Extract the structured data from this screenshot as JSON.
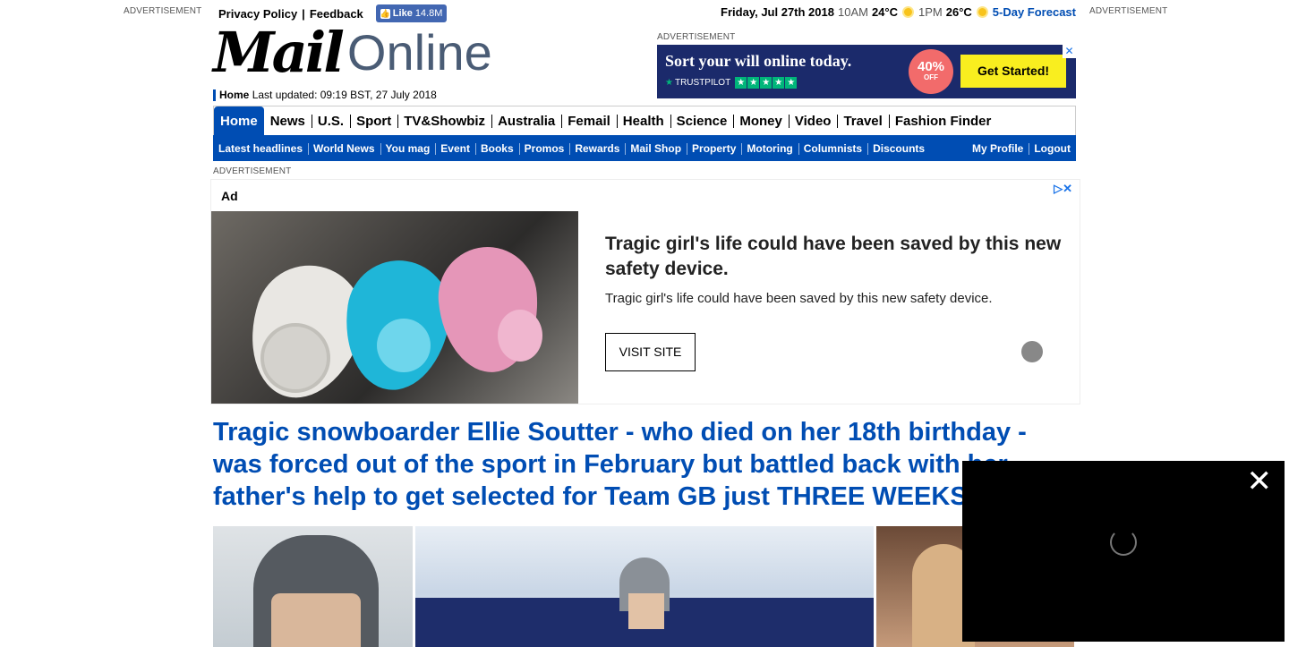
{
  "ads": {
    "left_label": "ADVERTISEMENT",
    "right_label": "ADVERTISEMENT",
    "banner_label": "ADVERTISEMENT",
    "mid_label": "ADVERTISEMENT"
  },
  "topbar": {
    "privacy": "Privacy Policy",
    "feedback": "Feedback",
    "like_label": "Like",
    "like_count": "14.8M"
  },
  "weather": {
    "date": "Friday, Jul 27th 2018",
    "t1_time": "10AM",
    "t1_temp": "24°C",
    "t2_time": "1PM",
    "t2_temp": "26°C",
    "forecast": "5-Day Forecast"
  },
  "logo": {
    "mail": "Mail",
    "online": "Online"
  },
  "updated": {
    "home": "Home",
    "text": "Last updated: 09:19 BST, 27 July 2018"
  },
  "banner": {
    "headline": "Sort your will online today.",
    "trustpilot": "TRUSTPILOT",
    "stars": [
      "★",
      "★",
      "★",
      "★",
      "★"
    ],
    "pct": "40%",
    "off": "OFF",
    "cta": "Get Started!",
    "close": "✕"
  },
  "nav_primary": [
    "Home",
    "News",
    "U.S.",
    "Sport",
    "TV&Showbiz",
    "Australia",
    "Femail",
    "Health",
    "Science",
    "Money",
    "Video",
    "Travel",
    "Fashion Finder"
  ],
  "nav_secondary": [
    "Latest headlines",
    "World News",
    "You mag",
    "Event",
    "Books",
    "Promos",
    "Rewards",
    "Mail Shop",
    "Property",
    "Motoring",
    "Columnists",
    "Discounts"
  ],
  "nav_account": [
    "My Profile",
    "Logout"
  ],
  "native_ad": {
    "tag": "Ad",
    "choices": "▷✕",
    "title": "Tragic girl's life could have been saved by this new safety device.",
    "desc": "Tragic girl's life could have been saved by this new safety device.",
    "visit": "VISIT SITE"
  },
  "article": {
    "headline": "Tragic snowboarder Ellie Soutter - who died on her 18th birthday - was forced out of the sport in February but battled back with her father's help to get selected for Team GB just THREE WEEKS"
  },
  "video": {
    "close": "✕"
  }
}
